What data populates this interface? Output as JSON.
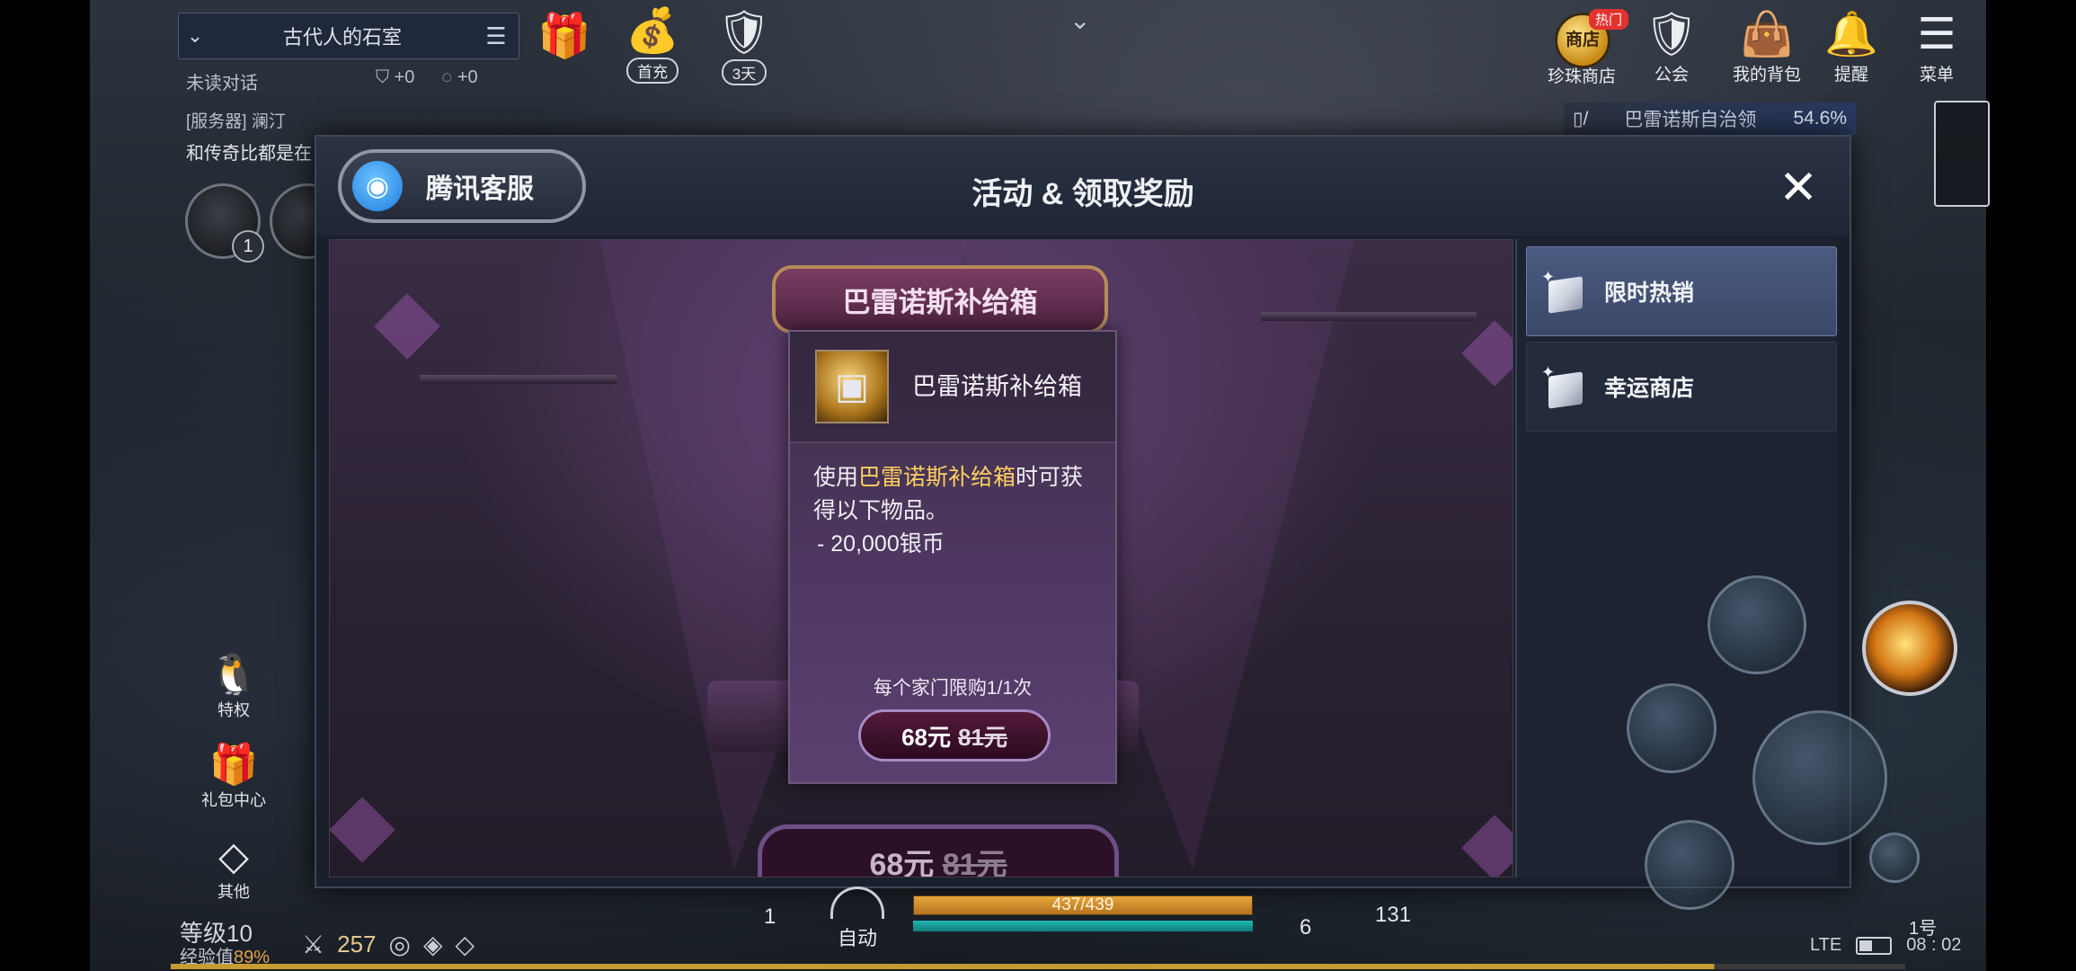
{
  "chat": {
    "location": "古代人的石室",
    "unread_label": "未读对话",
    "unread_shield": "+0",
    "unread_msg": "+0",
    "line1": "[服务器] 澜汀",
    "line2": "和传奇比都是在"
  },
  "avatar_badge": "1",
  "top_bar": {
    "first_charge": "首充",
    "days": "3天",
    "hot_badge": "热门",
    "shop_coin": "商店",
    "pearl_shop": "珍珠商店",
    "guild": "公会",
    "backpack": "我的背包",
    "reminder": "提醒",
    "menu": "菜单"
  },
  "region": {
    "name": "巴雷诺斯自治领",
    "percent": "54.6%"
  },
  "modal": {
    "cs_label": "腾讯客服",
    "title": "活动 & 领取奖励",
    "close": "✕"
  },
  "showcase": {
    "plate_title": "巴雷诺斯补给箱",
    "bg_price": "68元",
    "bg_old_price": "81元"
  },
  "tooltip": {
    "item_name": "巴雷诺斯补给箱",
    "desc_prefix": "使用",
    "desc_highlight": "巴雷诺斯补给箱",
    "desc_suffix": "时可获得以下物品。",
    "reward": "- 20,000银币",
    "limit": "每个家门限购1/1次",
    "price": "68元",
    "old_price": "81元"
  },
  "side_nav": [
    {
      "label": "限时热销",
      "active": true
    },
    {
      "label": "幸运商店",
      "active": false
    }
  ],
  "hud": {
    "privilege": "特权",
    "gift_center": "礼包中心",
    "other": "其他",
    "level": "等级10",
    "exp_label": "经验值",
    "exp_pct": "89%",
    "combat": "257",
    "slot1": "1",
    "auto": "自动",
    "hp": "437/439",
    "slot6": "6",
    "slot131": "131",
    "channel": "1号",
    "network": "LTE",
    "time": "08 : 02"
  },
  "colors": {
    "highlight": "#ffcf5e",
    "exp_pct": "#e2a247",
    "nav_active": "#4a5a80"
  }
}
